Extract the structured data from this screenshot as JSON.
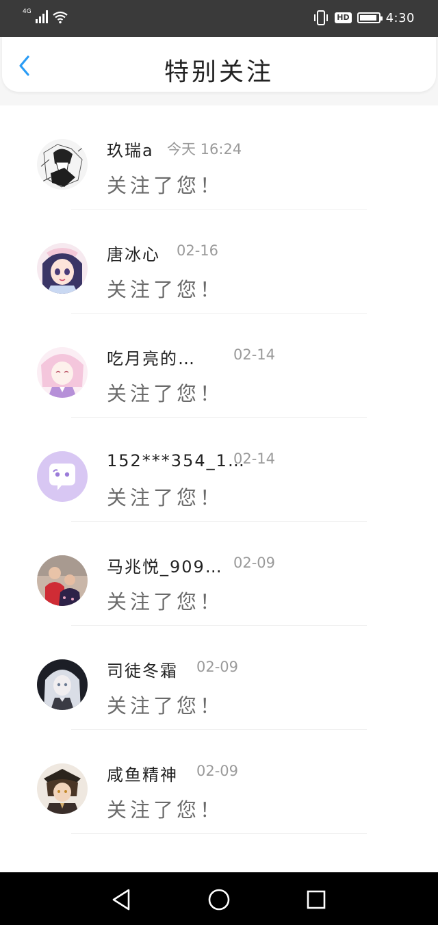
{
  "status_bar": {
    "network": "4G",
    "time": "4:30",
    "hd_label": "HD",
    "icons": [
      "signal-icon",
      "wifi-icon",
      "vibrate-icon",
      "hd-icon",
      "battery-icon"
    ]
  },
  "header": {
    "title": "特别关注",
    "back_icon": "chevron-left-icon",
    "accent_color": "#2a9cf5"
  },
  "items": [
    {
      "name": "玖瑞a",
      "time": "今天 16:24",
      "message": "关注了您！"
    },
    {
      "name": "唐冰心",
      "time": "02-16",
      "message": "关注了您！"
    },
    {
      "name": "吃月亮的…",
      "time": "02-14",
      "message": "关注了您！"
    },
    {
      "name": "152***354_1…",
      "time": "02-14",
      "message": "关注了您！"
    },
    {
      "name": "马兆悦_909…",
      "time": "02-09",
      "message": "关注了您！"
    },
    {
      "name": "司徒冬霜",
      "time": "02-09",
      "message": "关注了您！"
    },
    {
      "name": "咸鱼精神",
      "time": "02-09",
      "message": "关注了您！"
    }
  ],
  "nav_bar": {
    "icons": [
      "back-triangle-icon",
      "home-circle-icon",
      "recents-square-icon"
    ]
  }
}
